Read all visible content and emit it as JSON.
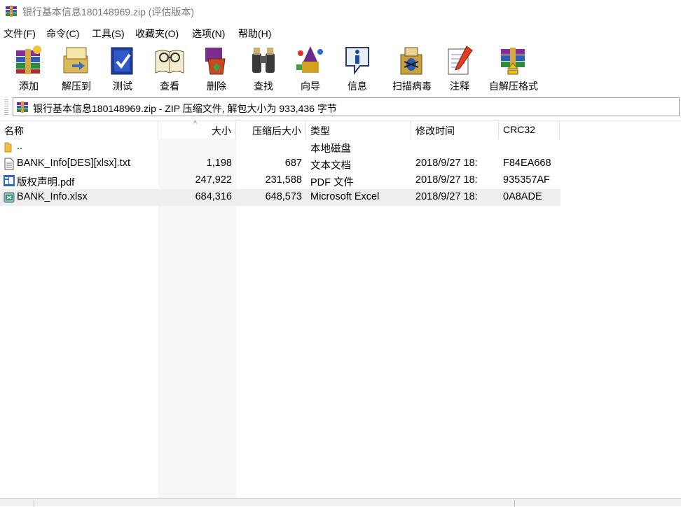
{
  "window": {
    "title": "银行基本信息180148969.zip (评估版本)"
  },
  "menu": [
    {
      "label": "文件(F)"
    },
    {
      "label": "命令(C)"
    },
    {
      "label": "工具(S)"
    },
    {
      "label": "收藏夹(O)"
    },
    {
      "label": "选项(N)"
    },
    {
      "label": "帮助(H)"
    }
  ],
  "toolbar": [
    {
      "label": "添加",
      "icon": "add-archive-icon"
    },
    {
      "label": "解压到",
      "icon": "extract-to-icon"
    },
    {
      "label": "测试",
      "icon": "test-icon"
    },
    {
      "label": "查看",
      "icon": "view-icon"
    },
    {
      "label": "删除",
      "icon": "delete-icon"
    },
    {
      "label": "查找",
      "icon": "find-binoculars-icon"
    },
    {
      "label": "向导",
      "icon": "wizard-icon"
    },
    {
      "label": "信息",
      "icon": "info-icon"
    },
    {
      "label": "扫描病毒",
      "icon": "virus-scan-icon"
    },
    {
      "label": "注释",
      "icon": "comment-icon"
    },
    {
      "label": "自解压格式",
      "icon": "sfx-icon"
    }
  ],
  "address": {
    "path": "银行基本信息180148969.zip - ZIP 压缩文件, 解包大小为 933,436 字节"
  },
  "columns": {
    "name": "名称",
    "size": "大小",
    "packed": "压缩后大小",
    "type": "类型",
    "modified": "修改时间",
    "crc": "CRC32"
  },
  "sort_indicator": "^",
  "files": [
    {
      "name": "..",
      "size": "",
      "packed": "",
      "type": "本地磁盘",
      "modified": "",
      "crc": "",
      "icon": "folder-icon",
      "selected": false
    },
    {
      "name": "BANK_Info[DES][xlsx].txt",
      "size": "1,198",
      "packed": "687",
      "type": "文本文档",
      "modified": "2018/9/27 18:",
      "crc": "F84EA668",
      "icon": "text-file-icon",
      "selected": false
    },
    {
      "name": "版权声明.pdf",
      "size": "247,922",
      "packed": "231,588",
      "type": "PDF 文件",
      "modified": "2018/9/27 18:",
      "crc": "935357AF",
      "icon": "pdf-file-icon",
      "selected": false
    },
    {
      "name": "BANK_Info.xlsx",
      "size": "684,316",
      "packed": "648,573",
      "type": "Microsoft Excel",
      "modified": "2018/9/27 18:",
      "crc": "0A8ADE",
      "icon": "excel-file-icon",
      "selected": true
    }
  ]
}
